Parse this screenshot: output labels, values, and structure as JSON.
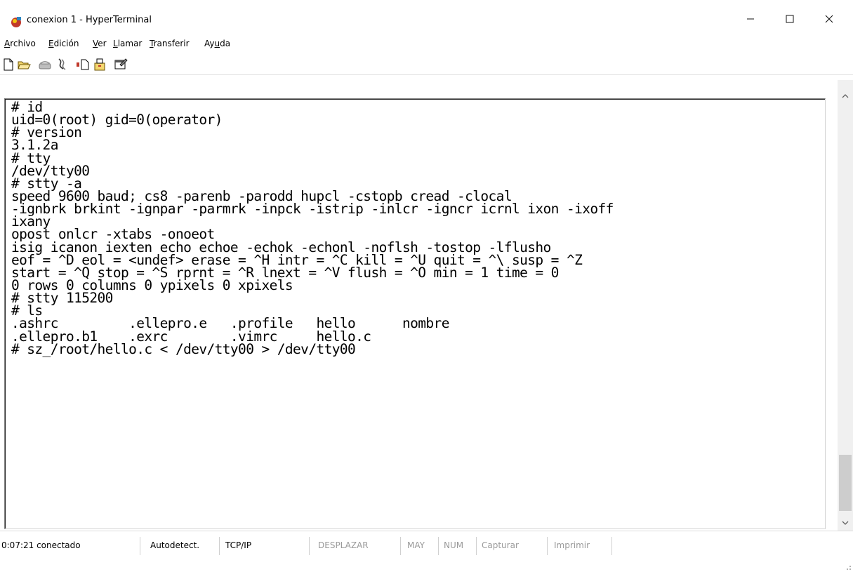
{
  "window": {
    "title": "conexion 1 - HyperTerminal",
    "controls": {
      "minimize": "–",
      "maximize": "☐",
      "close": "✕"
    }
  },
  "menu": [
    {
      "pre": "",
      "u": "A",
      "post": "rchivo"
    },
    {
      "pre": "",
      "u": "E",
      "post": "dición"
    },
    {
      "pre": "",
      "u": "V",
      "post": "er"
    },
    {
      "pre": "",
      "u": "L",
      "post": "lamar"
    },
    {
      "pre": "",
      "u": "T",
      "post": "ransferir"
    },
    {
      "pre": "Ay",
      "u": "u",
      "post": "da"
    }
  ],
  "toolbar": [
    {
      "icon": "new-connection-icon"
    },
    {
      "icon": "open-icon"
    },
    {
      "icon": "call-icon"
    },
    {
      "icon": "disconnect-icon"
    },
    {
      "icon": "send-icon"
    },
    {
      "icon": "receive-icon"
    },
    {
      "icon": "properties-icon"
    }
  ],
  "terminal": {
    "lines": [
      "# id",
      "uid=0(root) gid=0(operator)",
      "# version",
      "3.1.2a",
      "# tty",
      "/dev/tty00",
      "# stty -a",
      "speed 9600 baud; cs8 -parenb -parodd hupcl -cstopb cread -clocal",
      "-ignbrk brkint -ignpar -parmrk -inpck -istrip -inlcr -igncr icrnl ixon -ixoff",
      "ixany",
      "opost onlcr -xtabs -onoeot",
      "isig icanon iexten echo echoe -echok -echonl -noflsh -tostop -lflusho",
      "eof = ^D eol = <undef> erase = ^H intr = ^C kill = ^U quit = ^\\ susp = ^Z",
      "start = ^Q stop = ^S rprnt = ^R lnext = ^V flush = ^O min = 1 time = 0",
      "0 rows 0 columns 0 ypixels 0 xpixels",
      "# stty 115200",
      "# ls",
      ".ashrc         .ellepro.e   .profile   hello      nombre",
      ".ellepro.b1    .exrc        .vimrc     hello.c",
      "# sz_/root/hello.c < /dev/tty00 > /dev/tty00"
    ]
  },
  "status": {
    "time": "0:07:21 conectado",
    "detect": "Autodetect.",
    "proto": "TCP/IP",
    "scroll": "DESPLAZAR",
    "caps": "MAY",
    "num": "NUM",
    "capture": "Capturar",
    "print": "Imprimir"
  },
  "colors": {
    "text": "#000000",
    "background": "#ffffff",
    "dim_text": "#9a9a9a",
    "scroll_track": "#f0f0f0"
  }
}
